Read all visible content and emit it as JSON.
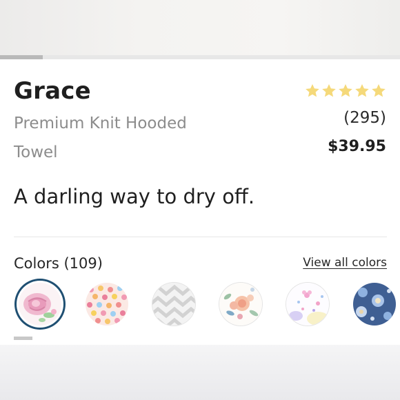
{
  "product": {
    "name": "Grace",
    "subtitle": "Premium Knit Hooded Towel",
    "rating_stars": 5,
    "review_count": "(295)",
    "price": "$39.95",
    "tagline": "A darling way to dry off."
  },
  "colors": {
    "label": "Colors (109)",
    "view_all": "View all colors",
    "selected_index": 0,
    "swatch_names": [
      "pink-rose-icon",
      "watercolor-dots-icon",
      "gray-herringbone-icon",
      "peach-floral-icon",
      "pastel-confetti-icon",
      "navy-floral-icon"
    ]
  },
  "theme": {
    "star_color": "#f5d97a",
    "selected_ring": "#1f4f72",
    "text_dark": "#1f1f1f",
    "text_muted": "#8c8c8c"
  }
}
